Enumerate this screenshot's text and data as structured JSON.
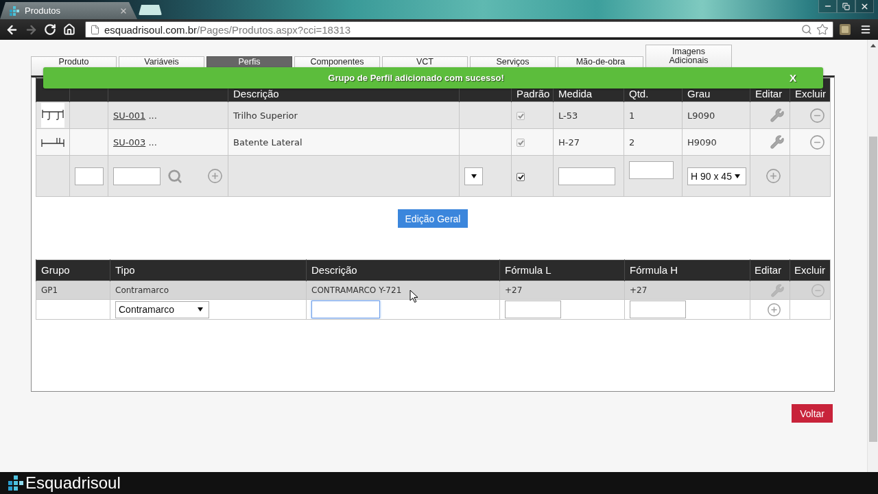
{
  "browser": {
    "tab_title": "Produtos",
    "url": "esquadrisoul.com.br/Pages/Produtos.aspx?cci=18313"
  },
  "tabs": [
    {
      "label": "Produto",
      "selected": false
    },
    {
      "label": "Variáveis",
      "selected": false
    },
    {
      "label": "Perfis",
      "selected": true
    },
    {
      "label": "Componentes",
      "selected": false
    },
    {
      "label": "VCT",
      "selected": false
    },
    {
      "label": "Serviços",
      "selected": false
    },
    {
      "label": "Mão-de-obra",
      "selected": false
    },
    {
      "label": "Imagens Adicionais",
      "selected": false
    }
  ],
  "toast": {
    "message": "Grupo de Perfil adicionado com sucesso!",
    "close_label": "X"
  },
  "profiles_table": {
    "columns": [
      "Descrição",
      "Padrão",
      "Medida",
      "Qtd.",
      "Grau",
      "Editar",
      "Excluir"
    ],
    "rows": [
      {
        "kind": "rail",
        "code": "SU-001",
        "more": "...",
        "description": "Trilho Superior",
        "default_checked": true,
        "default_disabled": true,
        "measure": "L-53",
        "quantity": "1",
        "grade": "L9090"
      },
      {
        "kind": "jamb",
        "code": "SU-003",
        "more": "...",
        "description": "Batente Lateral",
        "default_checked": true,
        "default_disabled": true,
        "measure": "H-27",
        "quantity": "2",
        "grade": "H9090"
      }
    ],
    "new_row": {
      "default_checked": true,
      "default_disabled": false,
      "grade": "H 90 x 45"
    }
  },
  "edit_all_button": "Edição Geral",
  "groups_table": {
    "columns": [
      "Grupo",
      "Tipo",
      "Descrição",
      "Fórmula L",
      "Fórmula H",
      "Editar",
      "Excluir"
    ],
    "rows": [
      {
        "group": "GP1",
        "type": "Contramarco",
        "description": "CONTRAMARCO Y-721",
        "formula_l": "+27",
        "formula_h": "+27"
      }
    ],
    "new_row": {
      "type": "Contramarco",
      "description_focused": true
    }
  },
  "back_button": "Voltar",
  "footer": {
    "logo_text": "Esquadrisoul"
  }
}
